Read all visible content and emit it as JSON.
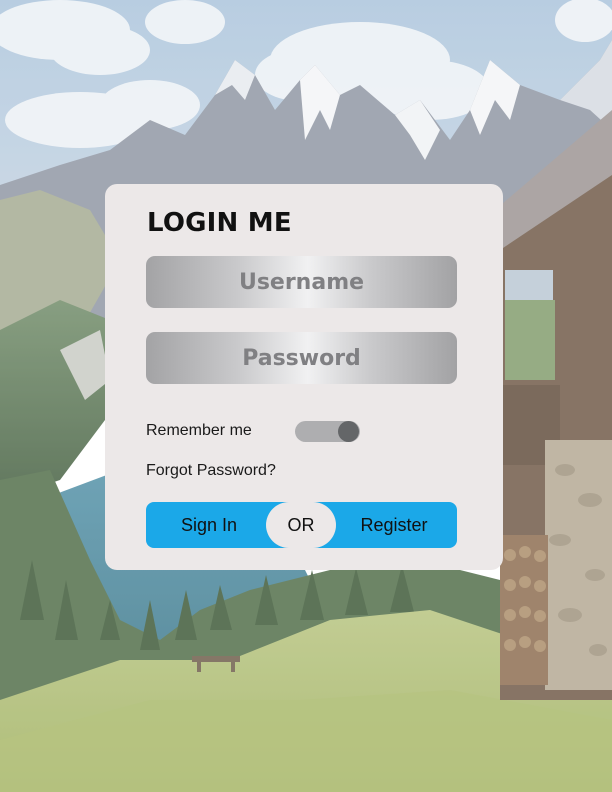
{
  "login_card": {
    "title": "LOGIN ME",
    "username_placeholder": "Username",
    "password_placeholder": "Password",
    "remember_label": "Remember me",
    "remember_enabled": true,
    "forgot_label": "Forgot Password?",
    "signin_label": "Sign In",
    "or_label": "OR",
    "register_label": "Register"
  },
  "colors": {
    "card_background": "#ece8e8",
    "button_blue": "#1ba8e8",
    "toggle_track": "#aeaeb0",
    "toggle_knob": "#646668"
  },
  "background": "mountain lake landscape photo with alpine cabin"
}
